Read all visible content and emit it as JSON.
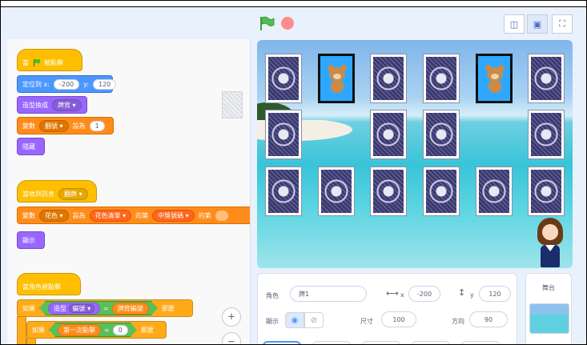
{
  "stage_header": {
    "flag_icon": "green-flag-icon",
    "stop_icon": "stop-sign-icon",
    "view_buttons": [
      {
        "icon": "small-stage-icon",
        "glyph": "◫"
      },
      {
        "icon": "normal-stage-icon",
        "glyph": "▣"
      },
      {
        "icon": "fullscreen-icon",
        "glyph": "⛶"
      }
    ]
  },
  "scripts": {
    "script1": {
      "hat_label": "當",
      "hat_suffix": "被點擊",
      "goto_label": "定位到 x:",
      "goto_x": "-200",
      "goto_y_label": "y:",
      "goto_y": "120",
      "costume_label": "造型換成",
      "costume_value": "牌背",
      "setvar_label": "變數",
      "setvar_var": "翻號",
      "setvar_mid": "設為",
      "setvar_value": "1",
      "hide_label": "隱藏"
    },
    "script2": {
      "hat_label": "當收到訊息",
      "hat_value": "翻牌",
      "setvar_label": "變數",
      "setvar_var": "花色",
      "setvar_mid": "設為",
      "list_value": "花色清單",
      "of_label": "的第",
      "index_value": "中獎號碼",
      "of_label2": "的第",
      "show_label": "顯示"
    },
    "script3": {
      "hat_label": "當角色被點擊",
      "if_label": "如果",
      "cond_left": "造型",
      "cond_left_value": "編號",
      "cond_op": "=",
      "cond_right": "牌背編號",
      "then_label": "那麼",
      "if2_label": "如果",
      "cond2_left": "第一次點擊",
      "cond2_op": "=",
      "cond2_right": "0",
      "then2_label": "那麼"
    }
  },
  "zoom": {
    "zoom_in": "+",
    "zoom_out": "−"
  },
  "stage": {
    "cards": [
      {
        "row": 0,
        "col": 0,
        "state": "back"
      },
      {
        "row": 0,
        "col": 1,
        "state": "face"
      },
      {
        "row": 0,
        "col": 2,
        "state": "back"
      },
      {
        "row": 0,
        "col": 3,
        "state": "back"
      },
      {
        "row": 0,
        "col": 4,
        "state": "face"
      },
      {
        "row": 0,
        "col": 5,
        "state": "back"
      },
      {
        "row": 1,
        "col": 0,
        "state": "back"
      },
      {
        "row": 1,
        "col": 2,
        "state": "back"
      },
      {
        "row": 1,
        "col": 3,
        "state": "back"
      },
      {
        "row": 1,
        "col": 5,
        "state": "back"
      },
      {
        "row": 2,
        "col": 0,
        "state": "back"
      },
      {
        "row": 2,
        "col": 1,
        "state": "back"
      },
      {
        "row": 2,
        "col": 2,
        "state": "back"
      },
      {
        "row": 2,
        "col": 3,
        "state": "back"
      },
      {
        "row": 2,
        "col": 4,
        "state": "back"
      },
      {
        "row": 2,
        "col": 5,
        "state": "back"
      }
    ]
  },
  "sprite_info": {
    "sprite_label": "角色",
    "sprite_name": "牌1",
    "x_label": "x",
    "x_value": "-200",
    "y_label": "y",
    "y_value": "120",
    "show_label": "顯示",
    "size_label": "尺寸",
    "size_value": "100",
    "direction_label": "方向",
    "direction_value": "90"
  },
  "stage_panel": {
    "label": "舞台"
  }
}
